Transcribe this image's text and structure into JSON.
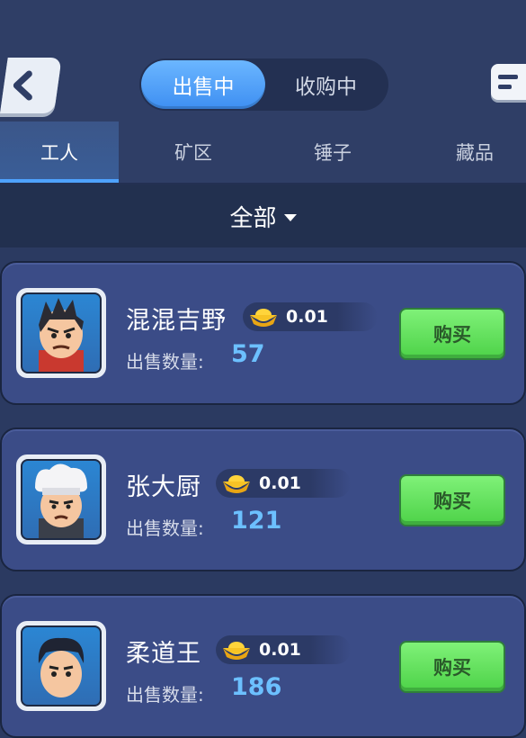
{
  "header": {
    "segments": [
      {
        "label": "出售中",
        "active": true
      },
      {
        "label": "收购中",
        "active": false
      }
    ]
  },
  "tabs": [
    {
      "label": "工人",
      "active": true
    },
    {
      "label": "矿区",
      "active": false
    },
    {
      "label": "锤子",
      "active": false
    },
    {
      "label": "藏品",
      "active": false
    }
  ],
  "filter": {
    "label": "全部"
  },
  "listings": [
    {
      "name": "混混吉野",
      "price": "0.01",
      "qty_label": "出售数量:",
      "qty": "57",
      "buy_label": "购买",
      "avatar": "thug-worker-portrait"
    },
    {
      "name": "张大厨",
      "price": "0.01",
      "qty_label": "出售数量:",
      "qty": "121",
      "buy_label": "购买",
      "avatar": "chef-worker-portrait"
    },
    {
      "name": "柔道王",
      "price": "0.01",
      "qty_label": "出售数量:",
      "qty": "186",
      "buy_label": "购买",
      "avatar": "judo-worker-portrait"
    }
  ],
  "icons": {
    "back": "chevron-left-icon",
    "menu": "menu-list-icon",
    "currency": "gold-ingot-icon"
  },
  "colors": {
    "accent_blue": "#4ea2ff",
    "buy_green": "#5fe15a",
    "qty_blue": "#6cc0ff"
  }
}
